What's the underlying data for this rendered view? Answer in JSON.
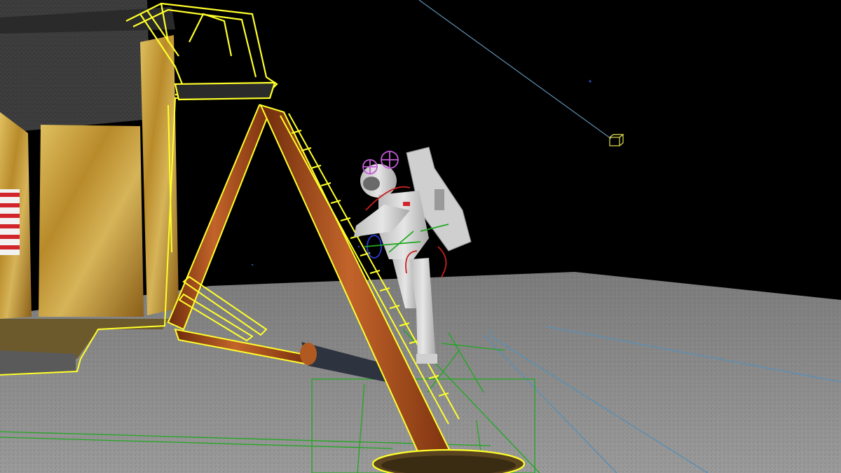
{
  "viewport": {
    "kind": "3d-perspective-viewport",
    "scene": "lunar-module-landing-scene",
    "objects": [
      "lunar-module",
      "lunar-module-ladder",
      "landing-leg-strut",
      "footpad",
      "astronaut",
      "camera-target-locator",
      "ground-plane"
    ],
    "colors": {
      "sky": "#000000",
      "ground": "#8a8a8a",
      "selection_outline": "#ffff2a",
      "gold_foil": "#c9a23c",
      "rust_leg": "#a34a17",
      "astronaut_suit": "#d8d8d8",
      "rig_green": "#1fa81f",
      "rig_magenta": "#c45ad8",
      "rig_red": "#c8201e",
      "rig_blue": "#2a3cdb",
      "guide_blue": "#5f8fb0",
      "flag_red": "#d2252b"
    }
  }
}
